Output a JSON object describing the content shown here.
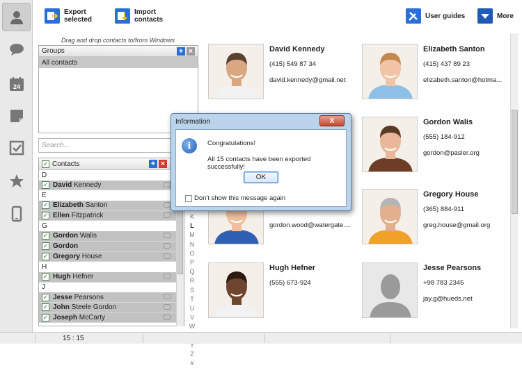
{
  "toolbar": {
    "export_line1": "Export",
    "export_line2": "selected",
    "import_line1": "Import",
    "import_line2": "contacts",
    "user_guides": "User guides",
    "more": "More"
  },
  "rail": [
    "contacts-icon",
    "chat-icon",
    "calendar-icon",
    "notes-icon",
    "tasks-icon",
    "favorites-icon",
    "phone-icon"
  ],
  "calendar_day": "24",
  "left_panel": {
    "hint": "Drag and drop contacts to/from Windows",
    "groups_label": "Groups",
    "groups": [
      "All contacts"
    ],
    "search_placeholder": "Search...",
    "contacts_label": "Contacts"
  },
  "contact_list": [
    {
      "letter": "D"
    },
    {
      "first": "David",
      "last": "Kennedy"
    },
    {
      "letter": "E"
    },
    {
      "first": "Elizabeth",
      "last": "Santon"
    },
    {
      "first": "Ellen",
      "last": "Fitzpatrick"
    },
    {
      "letter": "G"
    },
    {
      "first": "Gordon",
      "last": "Walis"
    },
    {
      "first": "Gordon",
      "last": ""
    },
    {
      "first": "Gregory",
      "last": "House"
    },
    {
      "letter": "H"
    },
    {
      "first": "Hugh",
      "last": "Hefner"
    },
    {
      "letter": "J"
    },
    {
      "first": "Jesse",
      "last": "Pearsons"
    },
    {
      "first": "John",
      "last": "Steele Gordon"
    },
    {
      "first": "Joseph",
      "last": "McCarty"
    }
  ],
  "alphabet": [
    "K",
    "L",
    "M",
    "N",
    "O",
    "P",
    "Q",
    "R",
    "S",
    "T",
    "U",
    "V",
    "W",
    "X",
    "Y",
    "Z",
    "#"
  ],
  "alphabet_active": [
    "L"
  ],
  "cards": [
    {
      "name": "David Kennedy",
      "phone": "(415) 549 87 34",
      "email": "david.kennedy@gmail.net",
      "skin": "#d9a883",
      "shirt": "#f2f2f2",
      "hair": "#5b4030"
    },
    {
      "name": "Elizabeth Santon",
      "phone": "(415) 437 89 23",
      "email": "elizabeth.santon@hotma...",
      "skin": "#f0c4a4",
      "shirt": "#8dc0e6",
      "hair": "#c4884d"
    },
    {
      "name": "",
      "phone": "",
      "email": "",
      "skin": "",
      "shirt": "",
      "hair": ""
    },
    {
      "name": "Gordon Walis",
      "phone": "(555) 184-912",
      "email": "gordon@pasler.org",
      "skin": "#eab79a",
      "shirt": "#6e3d25",
      "hair": "#5a3a22"
    },
    {
      "name": "",
      "phone": "",
      "email": "gordon.wood@watergate....",
      "skin": "#efbf9d",
      "shirt": "#2f5fb2",
      "hair": "#3d2a1b"
    },
    {
      "name": "Gregory House",
      "phone": "(365) 884-911",
      "email": "greg.house@gmail.org",
      "skin": "#e3b08d",
      "shirt": "#f0a12a",
      "hair": "#b5b5b5"
    },
    {
      "name": "Hugh Hefner",
      "phone": "(555) 673-924",
      "email": "",
      "skin": "#6e4630",
      "shirt": "#f2f2f2",
      "hair": "#2a1a10"
    },
    {
      "name": "Jesse Pearsons",
      "phone": "+98 783 2345",
      "email": "jay.g@hueds.net",
      "skin": "",
      "shirt": "",
      "hair": ""
    }
  ],
  "status": {
    "time": "15 : 15"
  },
  "dialog": {
    "title": "Information",
    "close": "X",
    "line1": "Congratulations!",
    "line2": "All 15 contacts have been exported successfully!",
    "ok": "OK",
    "checkbox_label": "Don't show this message again"
  },
  "colors": {
    "accent_blue": "#1f5bb5",
    "export_icon": "#2a6fd6",
    "add_btn": "#2a6fd6",
    "delete_btn": "#d33a2a",
    "check_green": "#2a7a2a"
  }
}
